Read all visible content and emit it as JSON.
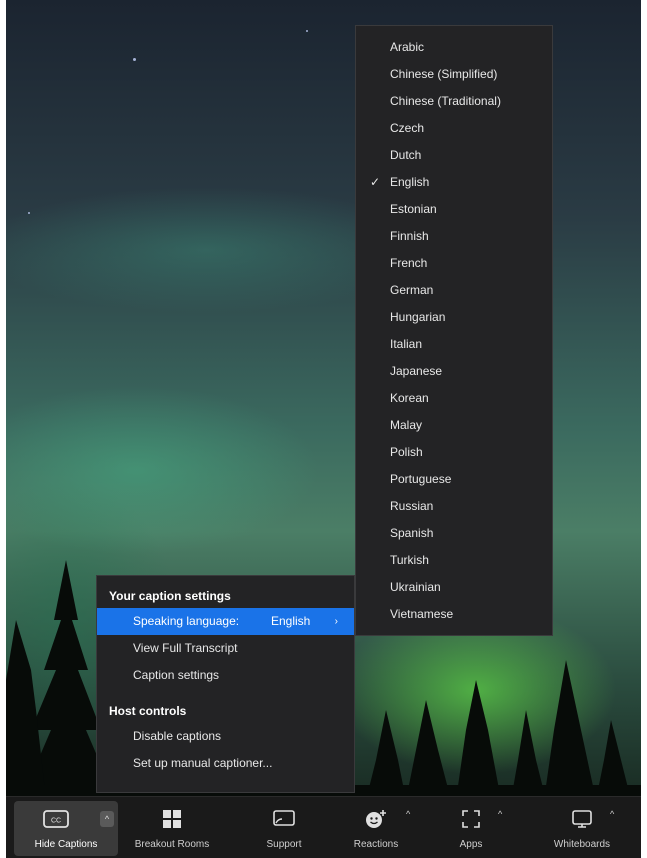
{
  "language_menu": {
    "items": [
      {
        "label": "Arabic",
        "checked": false
      },
      {
        "label": "Chinese (Simplified)",
        "checked": false
      },
      {
        "label": "Chinese (Traditional)",
        "checked": false
      },
      {
        "label": "Czech",
        "checked": false
      },
      {
        "label": "Dutch",
        "checked": false
      },
      {
        "label": "English",
        "checked": true
      },
      {
        "label": "Estonian",
        "checked": false
      },
      {
        "label": "Finnish",
        "checked": false
      },
      {
        "label": "French",
        "checked": false
      },
      {
        "label": "German",
        "checked": false
      },
      {
        "label": "Hungarian",
        "checked": false
      },
      {
        "label": "Italian",
        "checked": false
      },
      {
        "label": "Japanese",
        "checked": false
      },
      {
        "label": "Korean",
        "checked": false
      },
      {
        "label": "Malay",
        "checked": false
      },
      {
        "label": "Polish",
        "checked": false
      },
      {
        "label": "Portuguese",
        "checked": false
      },
      {
        "label": "Russian",
        "checked": false
      },
      {
        "label": "Spanish",
        "checked": false
      },
      {
        "label": "Turkish",
        "checked": false
      },
      {
        "label": "Ukrainian",
        "checked": false
      },
      {
        "label": "Vietnamese",
        "checked": false
      }
    ],
    "check_glyph": "✓"
  },
  "caption_menu": {
    "your_settings_heading": "Your caption settings",
    "speaking_language_label": "Speaking language:",
    "speaking_language_value": "English",
    "submenu_arrow": "›",
    "view_transcript": "View Full Transcript",
    "caption_settings": "Caption settings",
    "host_controls_heading": "Host controls",
    "disable_captions": "Disable captions",
    "manual_captioner": "Set up manual captioner..."
  },
  "toolbar": {
    "hide_captions": "Hide Captions",
    "cc_icon_text": "CC",
    "breakout_rooms": "Breakout Rooms",
    "support": "Support",
    "reactions": "Reactions",
    "apps": "Apps",
    "whiteboards": "Whiteboards",
    "chevron_up": "^"
  },
  "colors": {
    "menu_bg": "#232325",
    "highlight": "#1a73e8",
    "toolbar_bg": "#1a1a1a"
  }
}
